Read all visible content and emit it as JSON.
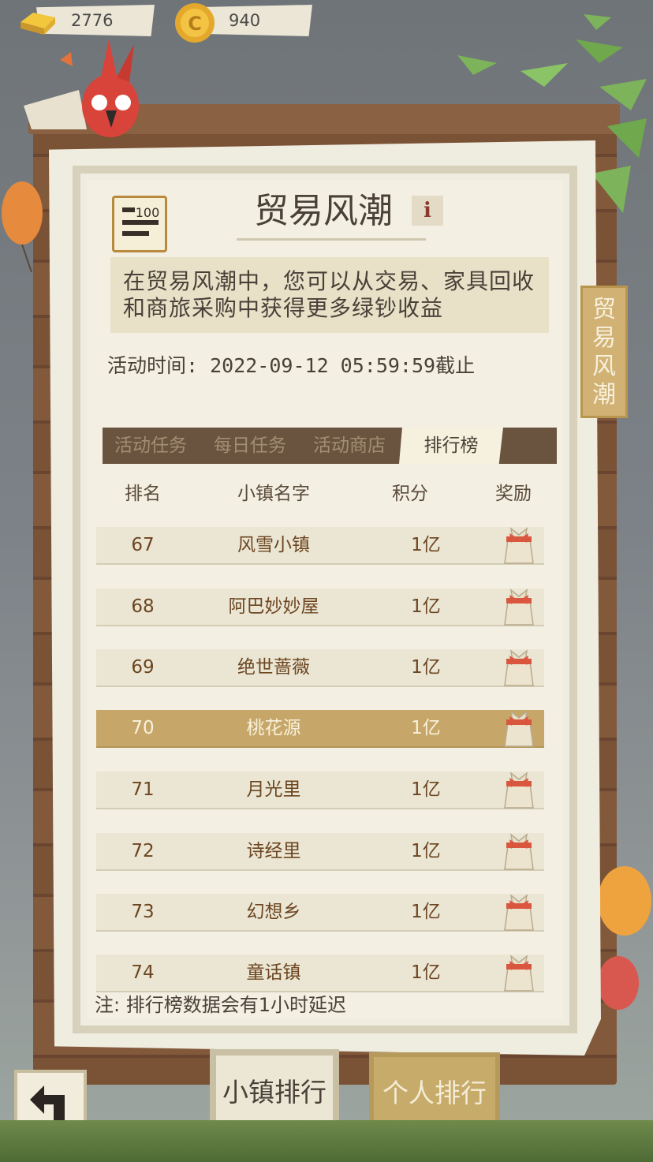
{
  "currency": {
    "gold": "2776",
    "coins": "940"
  },
  "header": {
    "title": "贸易风潮",
    "info_icon": "info-icon",
    "badge_icon": "rank-100-icon",
    "description": "在贸易风潮中，您可以从交易、家具回收和商旅采购中获得更多绿钞收益",
    "event_time": "活动时间: 2022-09-12 05:59:59截止"
  },
  "side_tab": {
    "label": "贸易风潮"
  },
  "tabs": [
    {
      "label": "活动任务",
      "active": false
    },
    {
      "label": "每日任务",
      "active": false
    },
    {
      "label": "活动商店",
      "active": false
    },
    {
      "label": "排行榜",
      "active": true
    }
  ],
  "table": {
    "headers": [
      "排名",
      "小镇名字",
      "积分",
      "奖励"
    ],
    "rows": [
      {
        "rank": "67",
        "name": "风雪小镇",
        "score": "1亿",
        "reward_icon": "gift-bag-icon"
      },
      {
        "rank": "68",
        "name": "阿巴妙妙屋",
        "score": "1亿",
        "reward_icon": "gift-bag-icon"
      },
      {
        "rank": "69",
        "name": "绝世蔷薇",
        "score": "1亿",
        "reward_icon": "gift-bag-icon"
      },
      {
        "rank": "70",
        "name": "桃花源",
        "score": "1亿",
        "reward_icon": "gift-bag-icon",
        "highlight": true
      },
      {
        "rank": "71",
        "name": "月光里",
        "score": "1亿",
        "reward_icon": "gift-bag-icon"
      },
      {
        "rank": "72",
        "name": "诗经里",
        "score": "1亿",
        "reward_icon": "gift-bag-icon"
      },
      {
        "rank": "73",
        "name": "幻想乡",
        "score": "1亿",
        "reward_icon": "gift-bag-icon"
      },
      {
        "rank": "74",
        "name": "童话镇",
        "score": "1亿",
        "reward_icon": "gift-bag-icon"
      }
    ]
  },
  "note": "注: 排行榜数据会有1小时延迟",
  "buttons": {
    "town_rank": "小镇排行",
    "personal_rank": "个人排行",
    "back_icon": "back-arrow-icon"
  },
  "colors": {
    "accent": "#c6a769",
    "text_dark": "#4a4038",
    "text_brown": "#6c4521",
    "paper": "#efece0",
    "wood": "#7a5236"
  }
}
